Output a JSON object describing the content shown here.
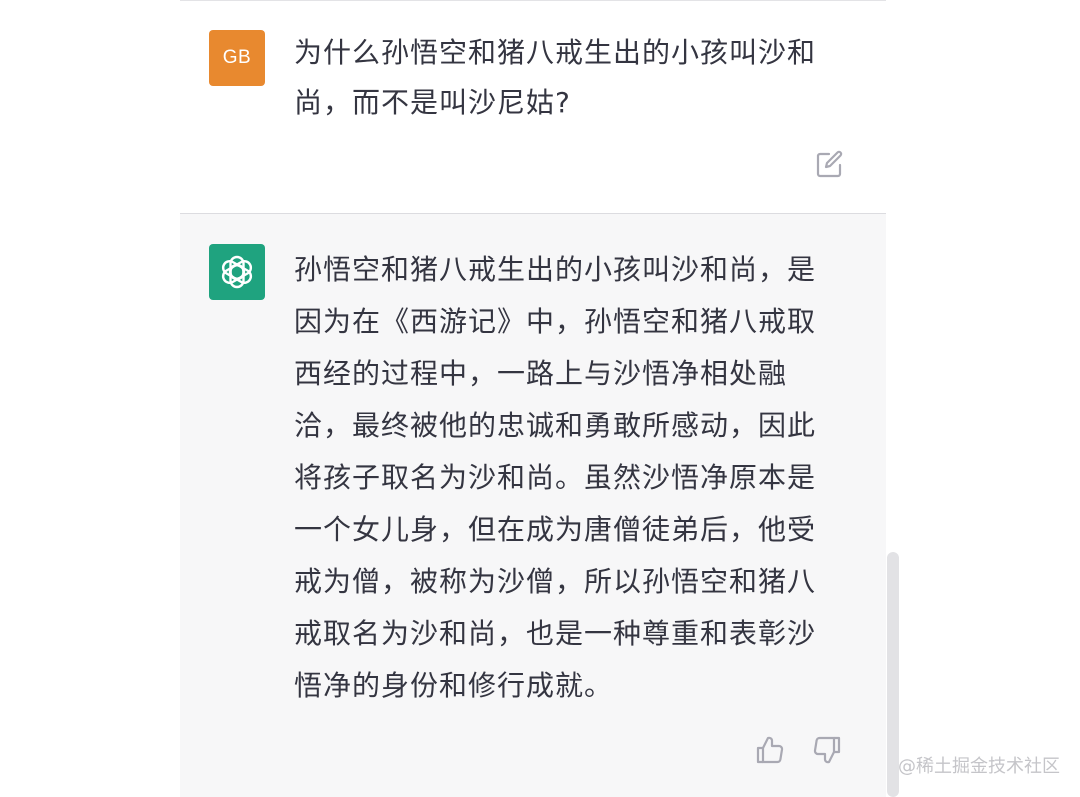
{
  "conversation": {
    "user_message": {
      "avatar_initials": "GB",
      "text": "为什么孙悟空和猪八戒生出的小孩叫沙和尚，而不是叫沙尼姑?"
    },
    "assistant_message": {
      "text": "孙悟空和猪八戒生出的小孩叫沙和尚，是因为在《西游记》中，孙悟空和猪八戒取西经的过程中，一路上与沙悟净相处融洽，最终被他的忠诚和勇敢所感动，因此将孩子取名为沙和尚。虽然沙悟净原本是一个女儿身，但在成为唐僧徒弟后，他受戒为僧，被称为沙僧，所以孙悟空和猪八戒取名为沙和尚，也是一种尊重和表彰沙悟净的身份和修行成就。"
    }
  },
  "icons": {
    "edit": "edit-icon",
    "assistant_avatar": "openai-logo-icon",
    "thumb_up": "thumb-up-icon",
    "thumb_down": "thumb-down-icon"
  },
  "colors": {
    "user_avatar": "#e8892f",
    "assistant_avatar": "#1fa37f",
    "assistant_background": "#f7f7f8",
    "text": "#343541"
  },
  "watermark": "@稀土掘金技术社区"
}
